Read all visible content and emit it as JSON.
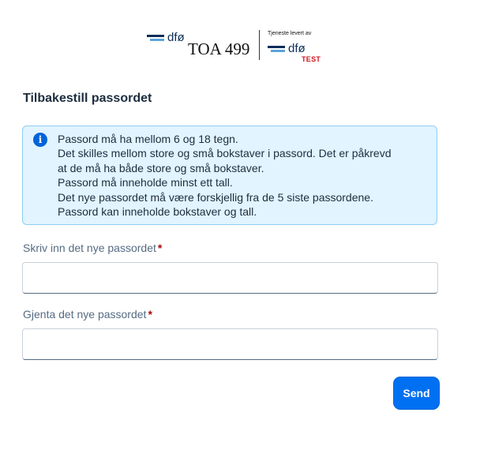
{
  "header": {
    "logo_left_text": "dfø",
    "app_title": "TOA 499",
    "delivered_by": "Tjeneste levert av",
    "logo_right_text": "dfø",
    "environment_badge": "TEST"
  },
  "page": {
    "title": "Tilbakestill passordet"
  },
  "info": {
    "icon": "info-icon",
    "lines": [
      "Passord må ha mellom 6 og 18 tegn.",
      "Det skilles mellom store og små bokstaver i passord. Det er påkrevd",
      "at de må ha både store og små bokstaver.",
      "Passord må inneholde minst ett tall.",
      "Det nye passordet må være forskjellig fra de 5 siste passordene.",
      "Passord kan inneholde bokstaver og tall."
    ]
  },
  "form": {
    "new_password": {
      "label": "Skriv inn det nye passordet",
      "required_mark": "*",
      "value": ""
    },
    "repeat_password": {
      "label": "Gjenta det nye passordet",
      "required_mark": "*",
      "value": ""
    },
    "submit_label": "Send"
  },
  "colors": {
    "primary": "#0070f2",
    "info_background": "#e1f4ff",
    "required": "#aa0808",
    "test_badge": "#d0141f"
  }
}
